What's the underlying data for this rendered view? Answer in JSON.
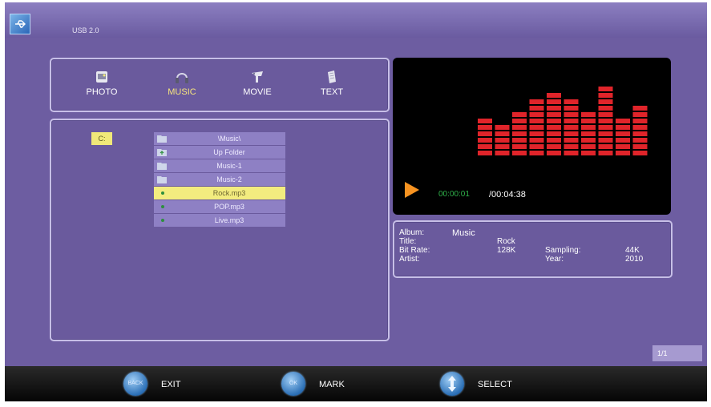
{
  "header": {
    "source_label": "USB 2.0"
  },
  "tabs": [
    {
      "label": "PHOTO",
      "icon": "photo-icon",
      "active": false
    },
    {
      "label": "MUSIC",
      "icon": "music-icon",
      "active": true
    },
    {
      "label": "MOVIE",
      "icon": "movie-icon",
      "active": false
    },
    {
      "label": "TEXT",
      "icon": "text-icon",
      "active": false
    }
  ],
  "browser": {
    "drive": "C:",
    "files": [
      {
        "name": "\\Music\\",
        "type": "folder",
        "selected": false
      },
      {
        "name": "Up Folder",
        "type": "up-folder",
        "selected": false
      },
      {
        "name": "Music-1",
        "type": "folder",
        "selected": false
      },
      {
        "name": "Music-2",
        "type": "folder",
        "selected": false
      },
      {
        "name": "Rock.mp3",
        "type": "audio",
        "selected": true
      },
      {
        "name": "POP.mp3",
        "type": "audio",
        "selected": false
      },
      {
        "name": "Live.mp3",
        "type": "audio",
        "selected": false
      }
    ]
  },
  "player": {
    "elapsed": "00:00:01",
    "total": "/00:04:38",
    "equalizer_levels": [
      0.52,
      0.45,
      0.57,
      0.79,
      0.86,
      0.79,
      0.64,
      0.93,
      0.52,
      0.72
    ],
    "colors": {
      "bars": "#e0242a",
      "play": "#f79321",
      "elapsed": "#2fb24a"
    }
  },
  "info": {
    "album_label": "Album:",
    "album_value": "Music",
    "title_label": "Title:",
    "title_value": "Rock",
    "bitrate_label": "Bit Rate:",
    "bitrate_value": "128K",
    "artist_label": "Artist:",
    "sampling_label": "Sampling:",
    "sampling_value": "44K",
    "year_label": "Year:",
    "year_value": "2010"
  },
  "pager": {
    "text": "1/1"
  },
  "footer": {
    "exit_btn": "BACK",
    "exit_label": "EXIT",
    "mark_btn": "OK",
    "mark_label": "MARK",
    "select_label": "SELECT"
  }
}
